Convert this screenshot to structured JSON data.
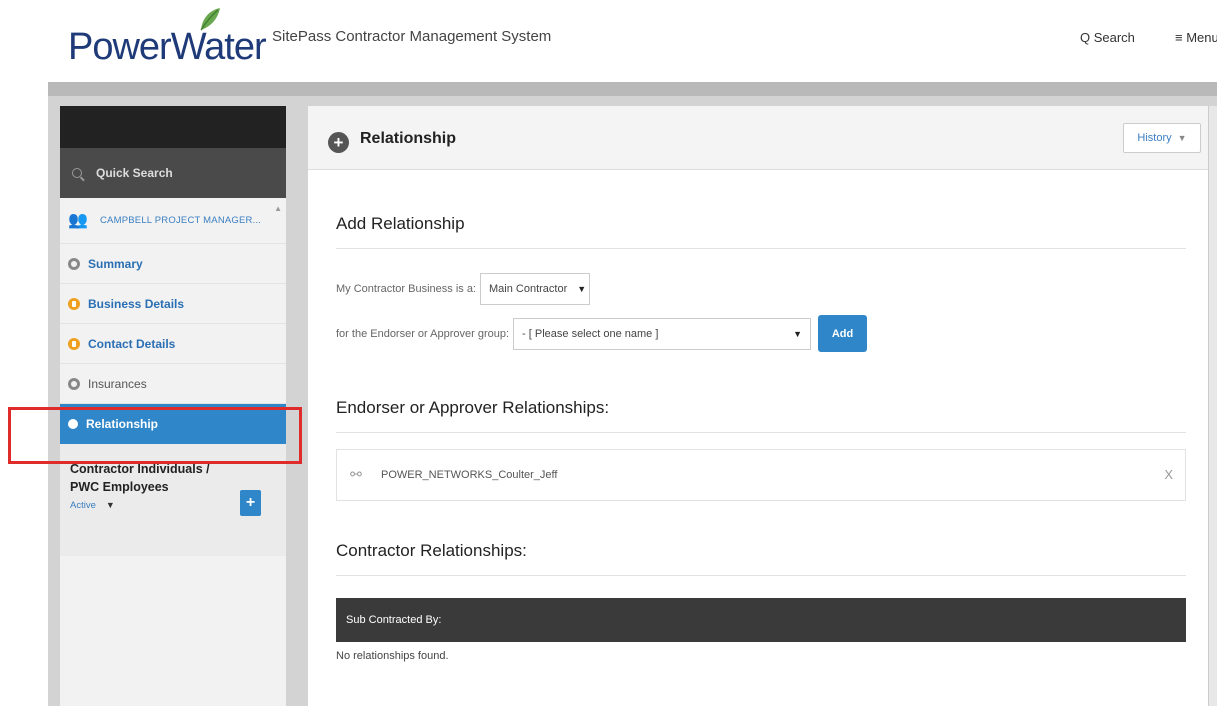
{
  "header": {
    "logo_text": "PowerWater",
    "app_title": "SitePass Contractor Management System",
    "search_label": "Q Search",
    "menu_label": "≡ Menu"
  },
  "sidebar": {
    "quick_search": "Quick Search",
    "company": "CAMPBELL PROJECT MANAGER...",
    "items": [
      {
        "label": "Summary",
        "status": "complete"
      },
      {
        "label": "Business Details",
        "status": "incomplete"
      },
      {
        "label": "Contact Details",
        "status": "incomplete"
      },
      {
        "label": "Insurances",
        "status": "complete"
      },
      {
        "label": "Relationship",
        "status": "active"
      }
    ],
    "contractors": {
      "title": "Contractor Individuals / PWC Employees",
      "status_filter": "Active",
      "add_label": "+"
    }
  },
  "main": {
    "title": "Relationship",
    "history_label": "History",
    "add_relationship": {
      "heading": "Add Relationship",
      "business_prefix": "My Contractor Business is a:",
      "business_role_value": "Main Contractor",
      "group_prefix": "for the Endorser or Approver group:",
      "group_value": "- [ Please select one name ]",
      "add_button": "Add"
    },
    "endorser_relationships": {
      "heading": "Endorser or Approver Relationships:",
      "items": [
        {
          "name": "POWER_NETWORKS_Coulter_Jeff",
          "remove": "X"
        }
      ]
    },
    "contractor_relationships": {
      "heading": "Contractor Relationships:",
      "table_header": "Sub Contracted By:",
      "empty_message": "No relationships found."
    }
  },
  "colors": {
    "brand_blue": "#1f3a78",
    "accent_blue": "#2f86c9",
    "highlight_red": "#e02b2b",
    "warning_orange": "#f0a020"
  }
}
